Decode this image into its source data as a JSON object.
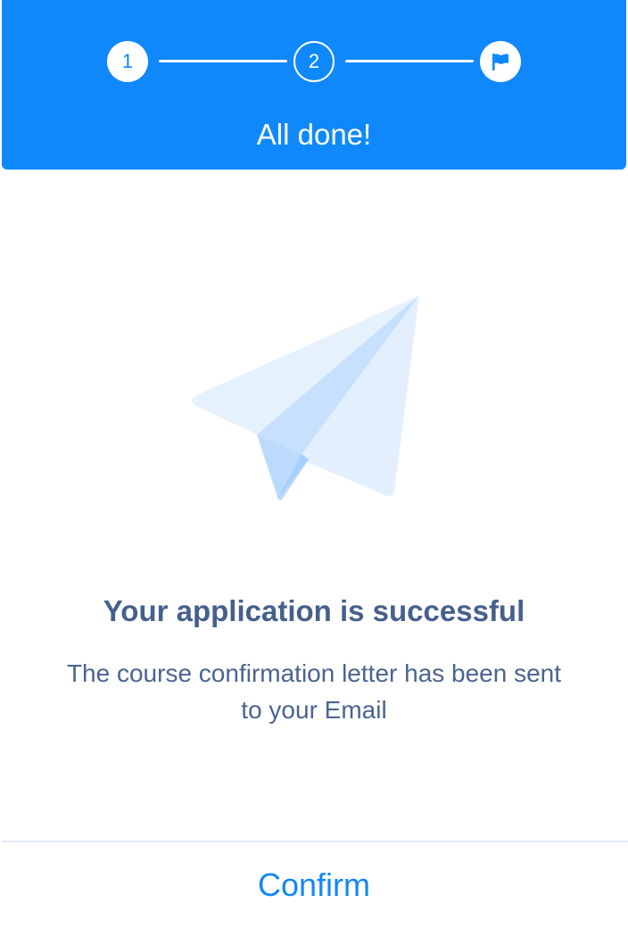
{
  "header": {
    "title": "All done!",
    "steps": [
      {
        "label": "1",
        "state": "completed"
      },
      {
        "label": "2",
        "state": "completed"
      },
      {
        "icon": "flag-icon",
        "state": "current"
      }
    ]
  },
  "main": {
    "illustration_icon": "paper-plane-icon",
    "title": "Your application is successful",
    "message": "The course confirmation letter has been sent to your Email"
  },
  "footer": {
    "confirm_label": "Confirm"
  },
  "colors": {
    "primary": "#0f88fb",
    "title_text": "#45608d",
    "body_text": "#4b6391",
    "divider": "#e1ebf3"
  }
}
